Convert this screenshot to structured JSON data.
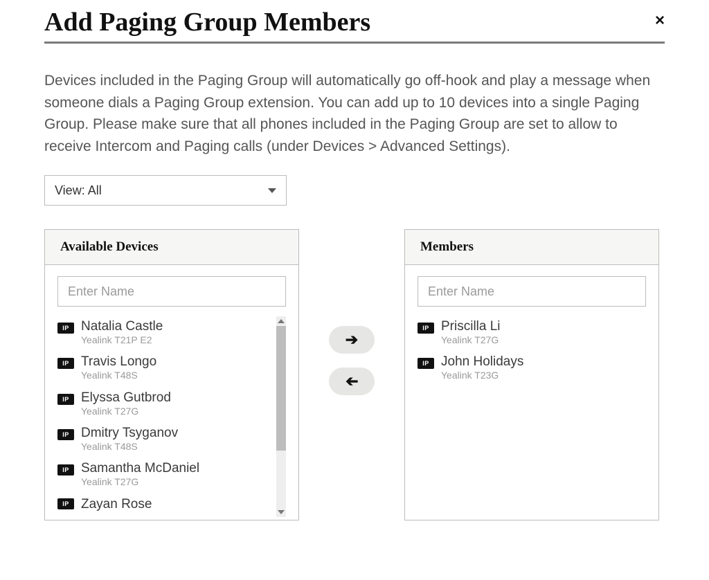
{
  "title": "Add Paging Group Members",
  "description": "Devices included in the Paging Group will automatically go off-hook and play a message when someone dials a Paging Group extension. You can add up to 10 devices into a single Paging Group. Please make sure that all phones included in the Paging Group are set to allow to receive Intercom and Paging calls (under Devices > Advanced Settings).",
  "view_filter": {
    "label": "View: All"
  },
  "icons": {
    "ip_badge": "IP"
  },
  "available": {
    "header": "Available Devices",
    "search_placeholder": "Enter Name",
    "items": [
      {
        "name": "Natalia Castle",
        "device": "Yealink T21P E2"
      },
      {
        "name": "Travis Longo",
        "device": "Yealink T48S"
      },
      {
        "name": "Elyssa Gutbrod",
        "device": "Yealink T27G"
      },
      {
        "name": "Dmitry Tsyganov",
        "device": "Yealink T48S"
      },
      {
        "name": "Samantha McDaniel",
        "device": "Yealink T27G"
      },
      {
        "name": "Zayan Rose",
        "device": ""
      }
    ]
  },
  "members": {
    "header": "Members",
    "search_placeholder": "Enter Name",
    "items": [
      {
        "name": "Priscilla Li",
        "device": "Yealink T27G"
      },
      {
        "name": "John Holidays",
        "device": "Yealink T23G"
      }
    ]
  }
}
